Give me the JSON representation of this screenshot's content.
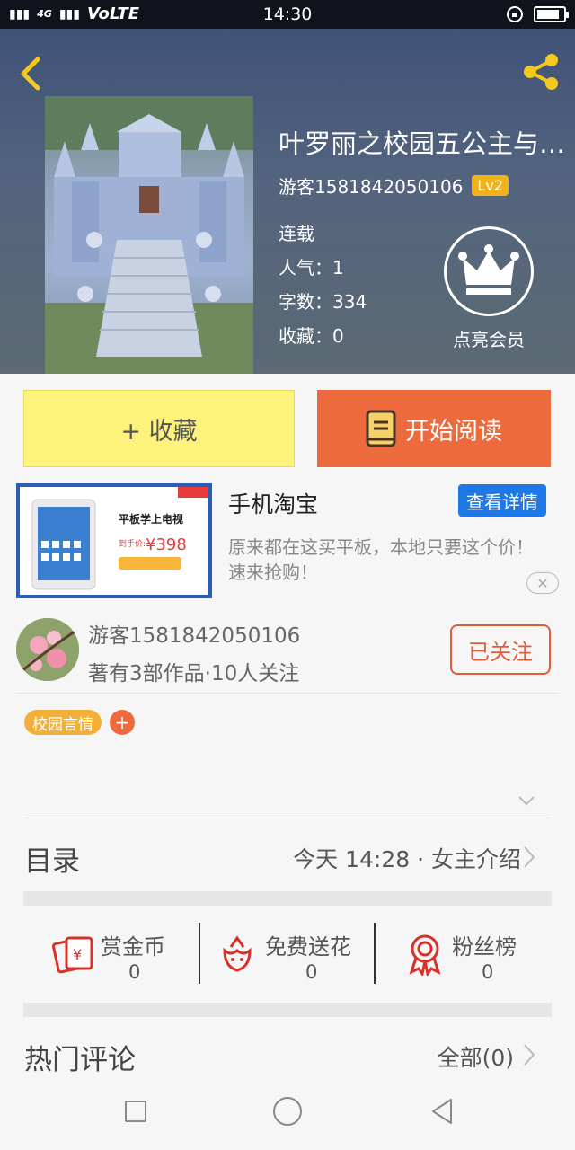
{
  "status": {
    "signal": "4G",
    "network": "VoLTE",
    "time": "14:30",
    "battery_pct": 0.85
  },
  "header": {
    "title": "叶罗丽之校园五公主与…",
    "author": "游客1581842050106",
    "level": "Lv2",
    "status_text": "连载",
    "popularity": "人气：1",
    "word_count": "字数：334",
    "favorites": "收藏：0",
    "vip_label": "点亮会员"
  },
  "actions": {
    "collect_label": "+ 收藏",
    "read_label": "开始阅读"
  },
  "ad": {
    "title": "手机淘宝",
    "details_label": "查看详情",
    "desc": "原来都在这买平板，本地只要这个价！速来抢购！",
    "close_label": "✕",
    "img_headline": "平板学上电视",
    "img_price": "¥398",
    "img_price_prefix": "到手价:"
  },
  "author": {
    "name": "游客1581842050106",
    "works": "著有3部作品·10人关注",
    "follow_label": "已关注"
  },
  "tags": {
    "tag1": "校园言情",
    "add": "+"
  },
  "catalog": {
    "title": "目录",
    "latest": "今天 14:28 · 女主介绍"
  },
  "stats": [
    {
      "label": "赏金币",
      "value": "0",
      "icon": "reward-coin-icon"
    },
    {
      "label": "免费送花",
      "value": "0",
      "icon": "flower-icon"
    },
    {
      "label": "粉丝榜",
      "value": "0",
      "icon": "badge-icon"
    }
  ],
  "hot_comments": {
    "title": "热门评论",
    "all_label": "全部(0)"
  },
  "colors": {
    "accent_orange": "#ec6a3c",
    "collect_yellow": "#fdf37c",
    "level_gold": "#f2b21a",
    "link_blue": "#1e78e6"
  }
}
